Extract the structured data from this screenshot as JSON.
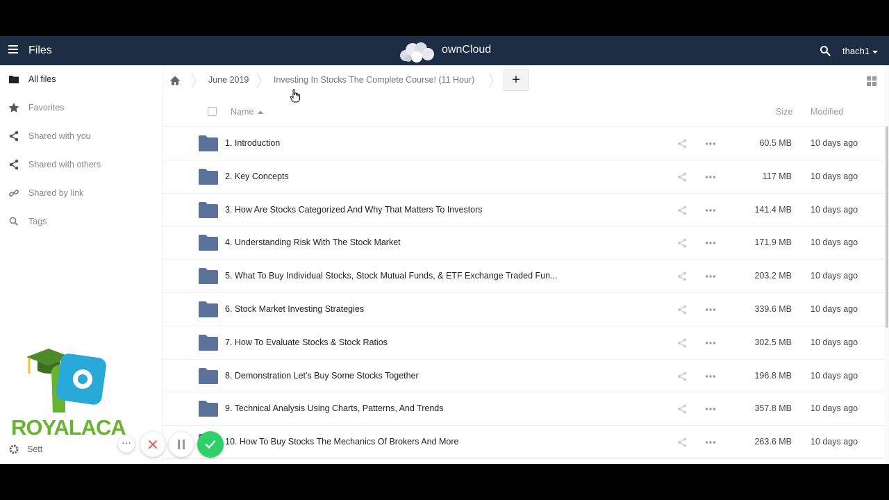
{
  "header": {
    "app_title": "Files",
    "brand": "ownCloud",
    "user": "thach1"
  },
  "sidebar": {
    "items": [
      {
        "label": "All files",
        "icon": "folder-icon",
        "active": true
      },
      {
        "label": "Favorites",
        "icon": "star-icon",
        "active": false
      },
      {
        "label": "Shared with you",
        "icon": "share-icon",
        "active": false
      },
      {
        "label": "Shared with others",
        "icon": "share-icon",
        "active": false
      },
      {
        "label": "Shared by link",
        "icon": "link-icon",
        "active": false
      },
      {
        "label": "Tags",
        "icon": "search-icon",
        "active": false
      }
    ],
    "settings_label": "Sett"
  },
  "watermark": {
    "text": "ROYALACA"
  },
  "breadcrumb": {
    "items": [
      "June 2019",
      "Investing In Stocks The Complete Course! (11 Hour)"
    ],
    "add_label": "+"
  },
  "table": {
    "columns": {
      "name": "Name",
      "size": "Size",
      "modified": "Modified"
    },
    "rows": [
      {
        "name": "1. Introduction",
        "size": "60.5 MB",
        "modified": "10 days ago"
      },
      {
        "name": "2. Key Concepts",
        "size": "117 MB",
        "modified": "10 days ago"
      },
      {
        "name": "3. How Are Stocks Categorized And Why That Matters To Investors",
        "size": "141.4 MB",
        "modified": "10 days ago"
      },
      {
        "name": "4. Understanding Risk With The Stock Market",
        "size": "171.9 MB",
        "modified": "10 days ago"
      },
      {
        "name": "5. What To Buy Individual Stocks, Stock Mutual Funds, & ETF Exchange Traded Fun...",
        "size": "203.2 MB",
        "modified": "10 days ago"
      },
      {
        "name": "6. Stock Market Investing Strategies",
        "size": "339.6 MB",
        "modified": "10 days ago"
      },
      {
        "name": "7. How To Evaluate Stocks & Stock Ratios",
        "size": "302.5 MB",
        "modified": "10 days ago"
      },
      {
        "name": "8. Demonstration Let's Buy Some Stocks Together",
        "size": "196.8 MB",
        "modified": "10 days ago"
      },
      {
        "name": "9. Technical Analysis Using Charts, Patterns, And Trends",
        "size": "357.8 MB",
        "modified": "10 days ago"
      },
      {
        "name": "10. How To Buy Stocks The Mechanics Of Brokers And More",
        "size": "263.6 MB",
        "modified": "10 days ago"
      }
    ]
  },
  "controls": {
    "more_label": "···"
  },
  "colors": {
    "header_bg": "#1d2d44",
    "folder": "#5a7199",
    "confirm": "#2fd06a",
    "cancel": "#e85d5d",
    "watermark_green": "#67b52e",
    "watermark_blue": "#29a9d8"
  }
}
